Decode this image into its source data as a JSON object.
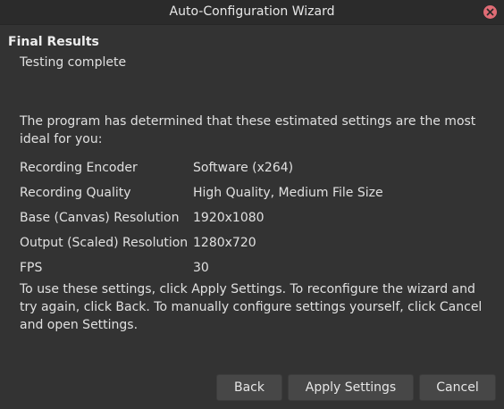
{
  "window": {
    "title": "Auto-Configuration Wizard"
  },
  "page": {
    "section_title": "Final Results",
    "subtitle": "Testing complete",
    "intro": "The program has determined that these estimated settings are the most ideal for you:",
    "settings": [
      {
        "label": "Recording Encoder",
        "value": "Software (x264)"
      },
      {
        "label": "Recording Quality",
        "value": "High Quality, Medium File Size"
      },
      {
        "label": "Base (Canvas) Resolution",
        "value": "1920x1080"
      },
      {
        "label": "Output (Scaled) Resolution",
        "value": "1280x720"
      },
      {
        "label": "FPS",
        "value": "30"
      }
    ],
    "footer_text": "To use these settings, click Apply Settings. To reconfigure the wizard and try again, click Back. To manually configure settings yourself, click Cancel and open Settings."
  },
  "buttons": {
    "back": "Back",
    "apply": "Apply Settings",
    "cancel": "Cancel"
  },
  "icons": {
    "close": "close-icon"
  },
  "colors": {
    "close_button": "#e06c75",
    "background": "#333333",
    "button": "#474747"
  }
}
